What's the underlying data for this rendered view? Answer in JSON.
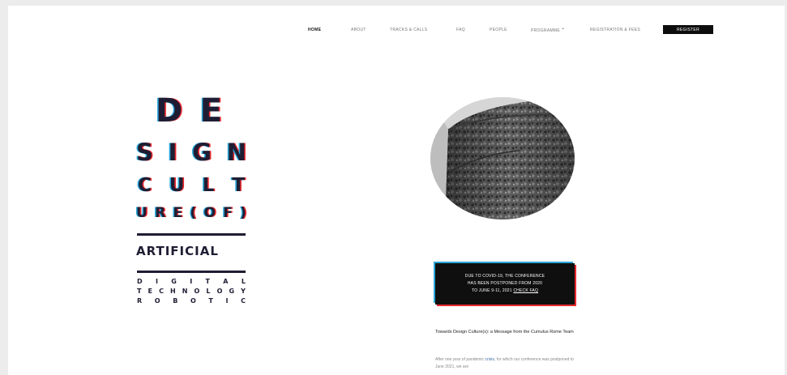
{
  "nav": {
    "items": [
      {
        "label": "HOME",
        "active": true
      },
      {
        "label": "ABOUT"
      },
      {
        "label": "TRACKS & CALLS"
      },
      {
        "label": "FAQ"
      },
      {
        "label": "PEOPLE"
      },
      {
        "label": "PROGRAMME"
      },
      {
        "label": "REGISTRATION & FEES"
      }
    ],
    "programme_caret": "⌄",
    "register_label": "REGISTER"
  },
  "logo": {
    "line1": [
      "D",
      "E"
    ],
    "line2": [
      "S",
      "I",
      "G",
      "N"
    ],
    "line3": [
      "C",
      "U",
      "L",
      "T"
    ],
    "line4": [
      "U",
      "R",
      "E",
      "(",
      "O",
      "F",
      ")"
    ],
    "line5": "ARTIFICIAL",
    "line6": [
      "D",
      "I",
      "G",
      "I",
      "T",
      "A",
      "L"
    ],
    "line7": [
      "T",
      "E",
      "C",
      "H",
      "N",
      "O",
      "L",
      "O",
      "G",
      "Y"
    ],
    "line8": [
      "R",
      "O",
      "B",
      "O",
      "T",
      "I",
      "C"
    ]
  },
  "notice": {
    "line1": "DUE TO COVID-19, THE CONFERENCE",
    "line2": "HAS BEEN POSTPONED FROM 2020",
    "line3_prefix": "TO JUNE 9-11, 2021 ",
    "line3_link": "CHECK FAQ"
  },
  "message": {
    "title": "Towards Design Culture(s): a Message from the Cumulus Rome Team",
    "body_prefix": "After one year of pandemic ",
    "body_highlight": "crisis",
    "body_suffix": ", for which our conference was postponed to June 2021, we are"
  },
  "colors": {
    "accent_blue": "#2aa7d8",
    "accent_red": "#e8292f",
    "logo_ink": "#1f1d33",
    "button_bg": "#0d0d0d"
  }
}
